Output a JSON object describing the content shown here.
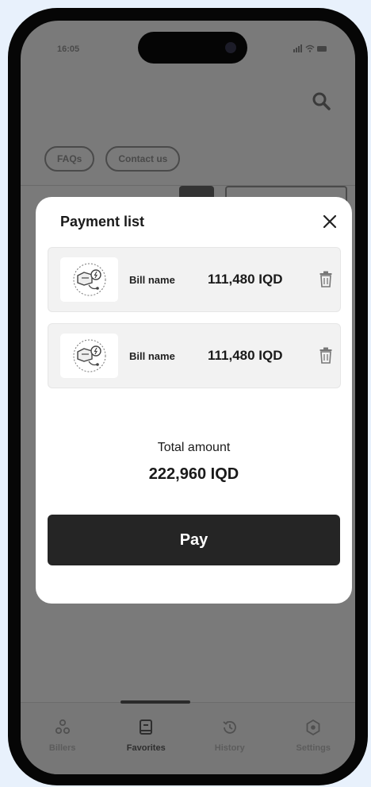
{
  "status_bar": {
    "time": "16:05"
  },
  "chips": [
    {
      "label": "FAQs"
    },
    {
      "label": "Contact us"
    }
  ],
  "modal": {
    "title": "Payment list",
    "items": [
      {
        "name": "Bill name",
        "amount": "111,480 IQD"
      },
      {
        "name": "Bill name",
        "amount": "111,480 IQD"
      }
    ],
    "total_label": "Total amount",
    "total_value": "222,960 IQD",
    "pay_label": "Pay"
  },
  "bottom_nav": {
    "items": [
      {
        "label": "Billers",
        "icon": "billers-icon"
      },
      {
        "label": "Favorites",
        "icon": "favorites-icon",
        "active": true
      },
      {
        "label": "History",
        "icon": "history-icon"
      },
      {
        "label": "Settings",
        "icon": "settings-icon"
      }
    ]
  }
}
